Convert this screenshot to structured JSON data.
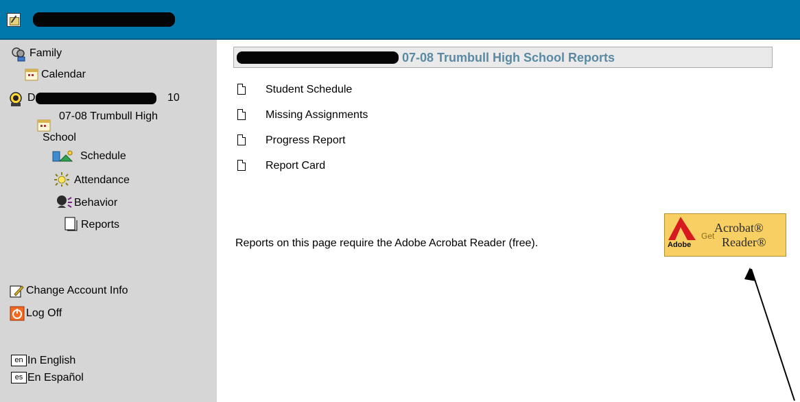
{
  "sidebar": {
    "family": "Family",
    "calendar": "Calendar",
    "student_prefix": "D",
    "student_suffix": "10",
    "school_line1": "07-08 Trumbull High",
    "school_line2": "School",
    "schedule": "Schedule",
    "attendance": "Attendance",
    "behavior": "Behavior",
    "reports": "Reports",
    "change_account": "Change Account Info",
    "log_off": "Log Off",
    "lang_en_code": "en",
    "lang_en": "In English",
    "lang_es_code": "es",
    "lang_es": "En Español"
  },
  "main": {
    "header_title": "07-08 Trumbull High School Reports",
    "reports": [
      "Student Schedule",
      "Missing Assignments",
      "Progress Report",
      "Report Card"
    ],
    "note": "Reports on this page require the Adobe Acrobat Reader (free).",
    "acrobat_badge": {
      "brand": "Adobe",
      "get": "Get",
      "line1": "Acrobat®",
      "line2": "Reader®"
    }
  }
}
